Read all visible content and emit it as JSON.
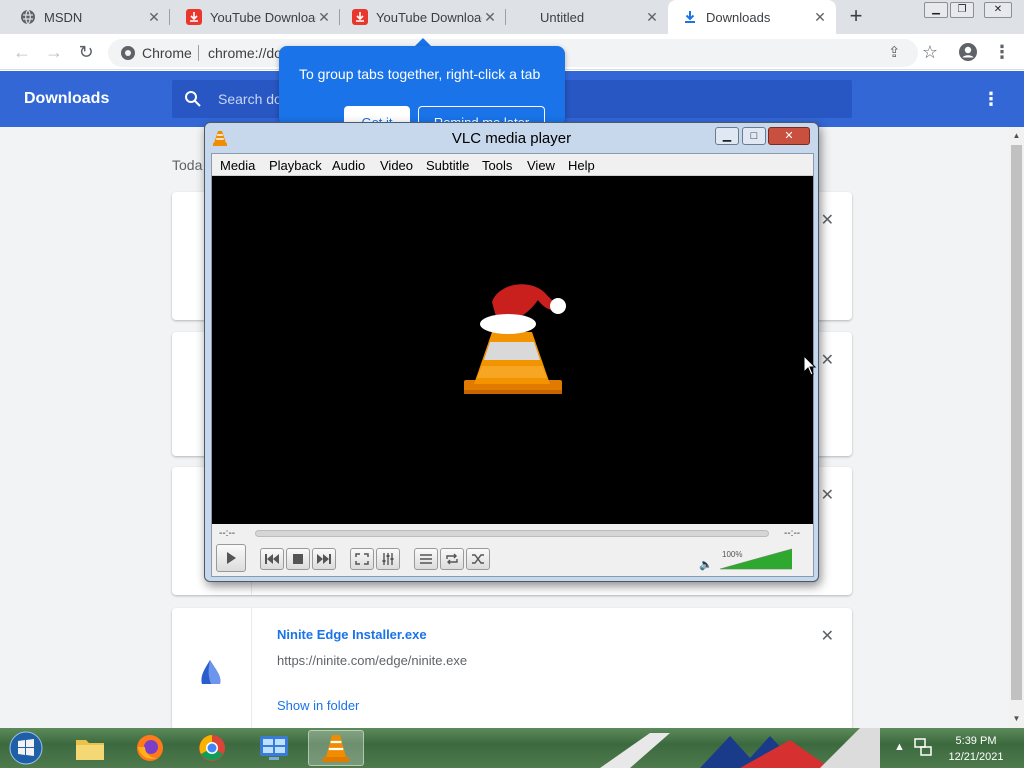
{
  "tabs": [
    {
      "title": "MSDN",
      "icon": "globe-icon",
      "active": false
    },
    {
      "title": "YouTube Download",
      "icon": "youtube-downloader-icon",
      "active": false
    },
    {
      "title": "YouTube Download",
      "icon": "youtube-downloader-icon",
      "active": false
    },
    {
      "title": "Untitled",
      "icon": "",
      "active": false
    },
    {
      "title": "Downloads",
      "icon": "download-icon",
      "active": true
    }
  ],
  "omnibox": {
    "site_label": "Chrome",
    "url": "chrome://do"
  },
  "downloads_page": {
    "title": "Downloads",
    "search_placeholder": "Search dow",
    "day_label": "Toda",
    "item": {
      "file_name": "Ninite Edge Installer.exe",
      "url": "https://ninite.com/edge/ninite.exe",
      "action": "Show in folder"
    }
  },
  "tab_group_bubble": {
    "text": "To group tabs together, right-click a tab",
    "got_it": "Got it",
    "remind_later": "Remind me later"
  },
  "vlc": {
    "title": "VLC media player",
    "menu": [
      "Media",
      "Playback",
      "Audio",
      "Video",
      "Subtitle",
      "Tools",
      "View",
      "Help"
    ],
    "time_elapsed": "--:--",
    "time_remaining": "--:--",
    "volume_label": "100%",
    "volume_level": 1.0
  },
  "taskbar": {
    "time": "5:39 PM",
    "date": "12/21/2021"
  },
  "colors": {
    "chrome_blue": "#3367d6",
    "bubble_blue": "#1a73e8",
    "vlc_orange": "#f08c00"
  }
}
